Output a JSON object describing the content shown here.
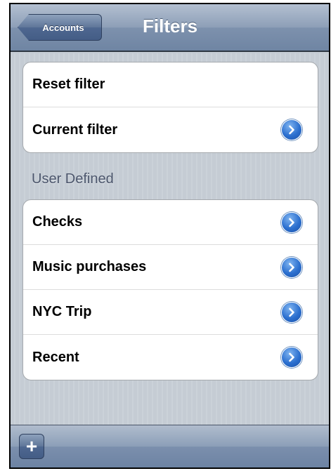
{
  "navbar": {
    "back_label": "Accounts",
    "title": "Filters"
  },
  "group1": {
    "rows": [
      {
        "label": "Reset filter",
        "has_disclosure": false
      },
      {
        "label": "Current filter",
        "has_disclosure": true
      }
    ]
  },
  "section": {
    "header": "User Defined"
  },
  "group2": {
    "rows": [
      {
        "label": "Checks",
        "has_disclosure": true
      },
      {
        "label": "Music purchases",
        "has_disclosure": true
      },
      {
        "label": "NYC Trip",
        "has_disclosure": true
      },
      {
        "label": "Recent",
        "has_disclosure": true
      }
    ]
  },
  "toolbar": {
    "add_label": "+"
  },
  "icons": {
    "disclosure": "chevron-right-circle-icon",
    "add": "plus-icon"
  },
  "colors": {
    "accent": "#2b6fcf",
    "background": "#c5ccd4",
    "navbar": "#7d91ad"
  }
}
